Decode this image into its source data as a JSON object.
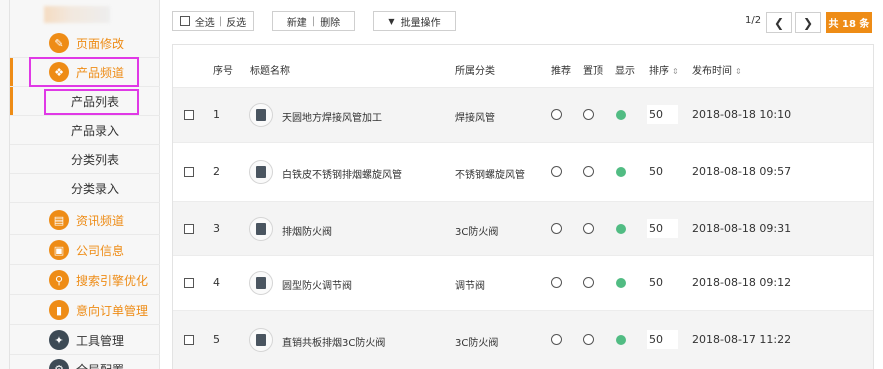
{
  "sidebar": {
    "items": [
      {
        "label": "页面修改",
        "icon": "pencil-icon",
        "level": "top"
      },
      {
        "label": "产品频道",
        "icon": "box-icon",
        "level": "top",
        "active": true
      },
      {
        "label": "产品列表",
        "level": "sub",
        "active": true
      },
      {
        "label": "产品录入",
        "level": "sub"
      },
      {
        "label": "分类列表",
        "level": "sub"
      },
      {
        "label": "分类录入",
        "level": "sub"
      },
      {
        "label": "资讯频道",
        "icon": "news-icon",
        "level": "top"
      },
      {
        "label": "公司信息",
        "icon": "company-icon",
        "level": "top"
      },
      {
        "label": "搜索引擎优化",
        "icon": "search-icon",
        "level": "top"
      },
      {
        "label": "意向订单管理",
        "icon": "order-icon",
        "level": "top"
      },
      {
        "label": "工具管理",
        "icon": "wrench-icon",
        "level": "top",
        "dark": true
      },
      {
        "label": "全局配置",
        "icon": "gear-icon",
        "level": "top",
        "dark": true
      }
    ]
  },
  "toolbar": {
    "select_all": "全选",
    "invert": "反选",
    "new": "新建",
    "delete": "删除",
    "batch": "批量操作",
    "batch_icon": "caret-down-icon",
    "sep": "|"
  },
  "pager": {
    "page": "1/2",
    "prev_icon": "chevron-left-icon",
    "next_icon": "chevron-right-icon",
    "total": "共 18 条"
  },
  "table": {
    "headers": {
      "num": "序号",
      "title": "标题名称",
      "category": "所属分类",
      "recommend": "推荐",
      "top": "置顶",
      "show": "显示",
      "order": "排序",
      "time": "发布时间",
      "sort_icon": "⇕"
    },
    "rows": [
      {
        "num": "1",
        "title": "天圆地方焊接风管加工",
        "category": "焊接风管",
        "order": "50",
        "time": "2018-08-18 10:10"
      },
      {
        "num": "2",
        "title": "白铁皮不锈钢排烟螺旋风管",
        "category": "不锈钢螺旋风管",
        "order": "50",
        "time": "2018-08-18 09:57"
      },
      {
        "num": "3",
        "title": "排烟防火阀",
        "category": "3C防火阀",
        "order": "50",
        "time": "2018-08-18 09:31"
      },
      {
        "num": "4",
        "title": "圆型防火调节阀",
        "category": "调节阀",
        "order": "50",
        "time": "2018-08-18 09:12"
      },
      {
        "num": "5",
        "title": "直销共板排烟3C防火阀",
        "category": "3C防火阀",
        "order": "50",
        "time": "2018-08-17 11:22"
      }
    ]
  },
  "colors": {
    "accent": "#ee8c16",
    "show_dot": "#51bc83",
    "highlight": "#e039e6"
  }
}
